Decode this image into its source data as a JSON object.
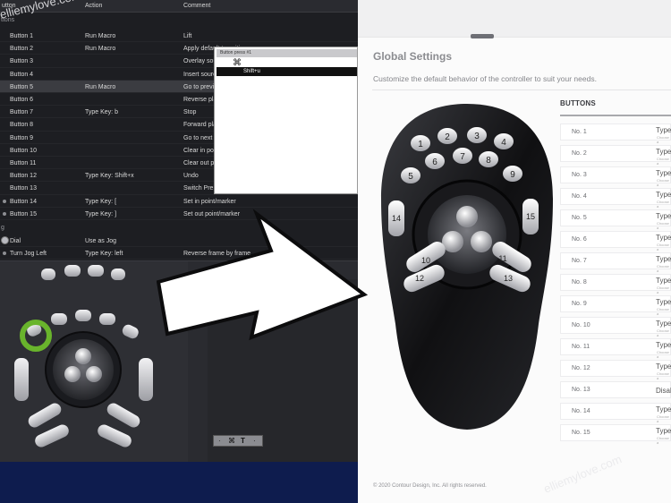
{
  "table": {
    "headers": [
      "utton",
      "Action",
      "Comment"
    ],
    "section_buttons": "ttons",
    "section_jog": "g",
    "rows": [
      {
        "button": "Button 1",
        "action": "Run Macro",
        "comment": "Lift"
      },
      {
        "button": "Button 2",
        "action": "Run Macro",
        "comment": "Apply default transition"
      },
      {
        "button": "Button 3",
        "action": "",
        "comment": "Overlay source clip at edit line"
      },
      {
        "button": "Button 4",
        "action": "",
        "comment": "Insert source clip at edit line"
      },
      {
        "button": "Button 5",
        "action": "Run Macro",
        "comment": "Go to previous edit"
      },
      {
        "button": "Button 6",
        "action": "",
        "comment": "Reverse play"
      },
      {
        "button": "Button 7",
        "action": "Type Key: b",
        "comment": "Stop"
      },
      {
        "button": "Button 8",
        "action": "",
        "comment": "Forward play"
      },
      {
        "button": "Button 9",
        "action": "",
        "comment": "Go to next edit"
      },
      {
        "button": "Button 10",
        "action": "",
        "comment": "Clear in point"
      },
      {
        "button": "Button 11",
        "action": "",
        "comment": "Clear out point"
      },
      {
        "button": "Button 12",
        "action": "Type Key: Shift+x",
        "comment": "Undo"
      },
      {
        "button": "Button 13",
        "action": "",
        "comment": "Switch Premiere Settings"
      },
      {
        "button": "Button 14",
        "action": "Type Key: [",
        "comment": "Set in point/marker"
      },
      {
        "button": "Button 15",
        "action": "Type Key: ]",
        "comment": "Set out point/marker"
      }
    ],
    "jog_rows": [
      {
        "button": "Dial",
        "action": "Use as Jog",
        "comment": ""
      },
      {
        "button": "Turn Jog Left",
        "action": "Type Key: left",
        "comment": "Reverse frame by frame"
      }
    ]
  },
  "key_editor": {
    "header": "Button press #1",
    "symbol": "⌘",
    "shortcut": "Shift+u",
    "toolbar": [
      "·",
      "⌘",
      "T",
      "·"
    ]
  },
  "watermark": "elliemylove.com",
  "global_settings": {
    "title": "Global Settings",
    "description": "Customize the default behavior of the controller to suit your needs.",
    "column_header": "BUTTONS",
    "rows": [
      {
        "no": "No. 1",
        "type": "Type",
        "sub": "Choose a"
      },
      {
        "no": "No. 2",
        "type": "Type",
        "sub": "Choose a"
      },
      {
        "no": "No. 3",
        "type": "Type",
        "sub": "Choose a"
      },
      {
        "no": "No. 4",
        "type": "Type",
        "sub": "Choose a"
      },
      {
        "no": "No. 5",
        "type": "Type",
        "sub": "Choose a"
      },
      {
        "no": "No. 6",
        "type": "Type",
        "sub": "Choose a"
      },
      {
        "no": "No. 7",
        "type": "Type",
        "sub": "Choose a"
      },
      {
        "no": "No. 8",
        "type": "Type",
        "sub": "Choose a"
      },
      {
        "no": "No. 9",
        "type": "Type",
        "sub": "Choose a"
      },
      {
        "no": "No. 10",
        "type": "Type",
        "sub": "Choose a"
      },
      {
        "no": "No. 11",
        "type": "Type",
        "sub": "Choose a"
      },
      {
        "no": "No. 12",
        "type": "Type",
        "sub": "Choose a"
      },
      {
        "no": "No. 13",
        "type": "Disal",
        "sub": ""
      },
      {
        "no": "No. 14",
        "type": "Type",
        "sub": "Choose a"
      },
      {
        "no": "No. 15",
        "type": "Type",
        "sub": "Choose a"
      }
    ],
    "copyright": "© 2020 Contour Design, Inc. All rights reserved."
  },
  "controller_labels": [
    "1",
    "2",
    "3",
    "4",
    "5",
    "6",
    "7",
    "8",
    "9",
    "10",
    "11",
    "12",
    "13",
    "14",
    "15"
  ],
  "colors": {
    "navy": "#0e1c4e",
    "highlight_ring": "#69b42c"
  }
}
